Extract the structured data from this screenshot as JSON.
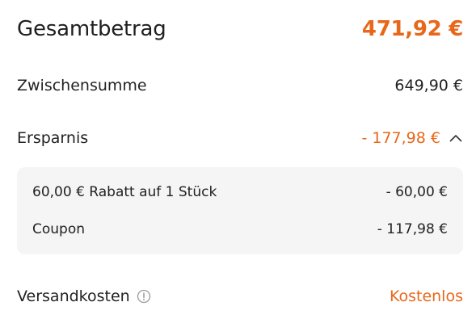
{
  "total": {
    "label": "Gesamtbetrag",
    "value": "471,92 €"
  },
  "subtotal": {
    "label": "Zwischensumme",
    "value": "649,90 €"
  },
  "savings": {
    "label": "Ersparnis",
    "value": "- 177,98 €",
    "expanded": true,
    "toggle_icon": "chevron-up-icon",
    "details": [
      {
        "label": "60,00 € Rabatt auf 1 Stück",
        "value": "- 60,00 €"
      },
      {
        "label": "Coupon",
        "value": "- 117,98 €"
      }
    ]
  },
  "shipping": {
    "label": "Versandkosten",
    "info_icon": "info-icon",
    "value": "Kostenlos"
  },
  "colors": {
    "accent": "#e7681b",
    "text": "#222222",
    "panel": "#f5f5f5"
  }
}
